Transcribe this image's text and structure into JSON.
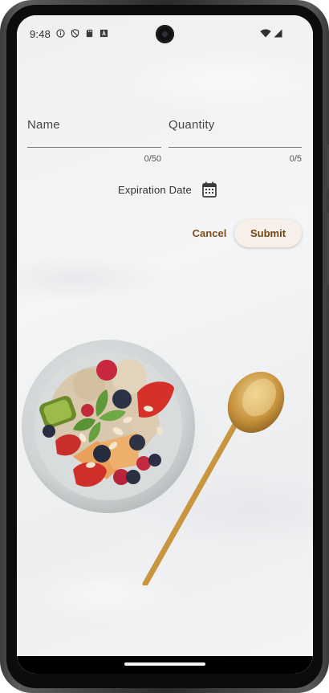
{
  "status_bar": {
    "time": "9:48",
    "left_icons": [
      "info-icon",
      "shield-icon",
      "sd-card-icon",
      "keyboard-a-icon"
    ],
    "right_icons": [
      "wifi-icon",
      "cellular-signal-icon"
    ]
  },
  "form": {
    "name": {
      "label": "Name",
      "value": "",
      "counter": "0/50"
    },
    "quantity": {
      "label": "Quantity",
      "value": "",
      "counter": "0/5"
    },
    "expiration": {
      "label": "Expiration Date",
      "icon": "calendar-icon"
    },
    "cancel_label": "Cancel",
    "submit_label": "Submit"
  },
  "background": {
    "image": "fruit-bowl-with-gold-spoon"
  },
  "colors": {
    "accent": "#7b4f1c",
    "submit_bg": "#f7efe9",
    "screen_bg": "#f2f3f4"
  }
}
